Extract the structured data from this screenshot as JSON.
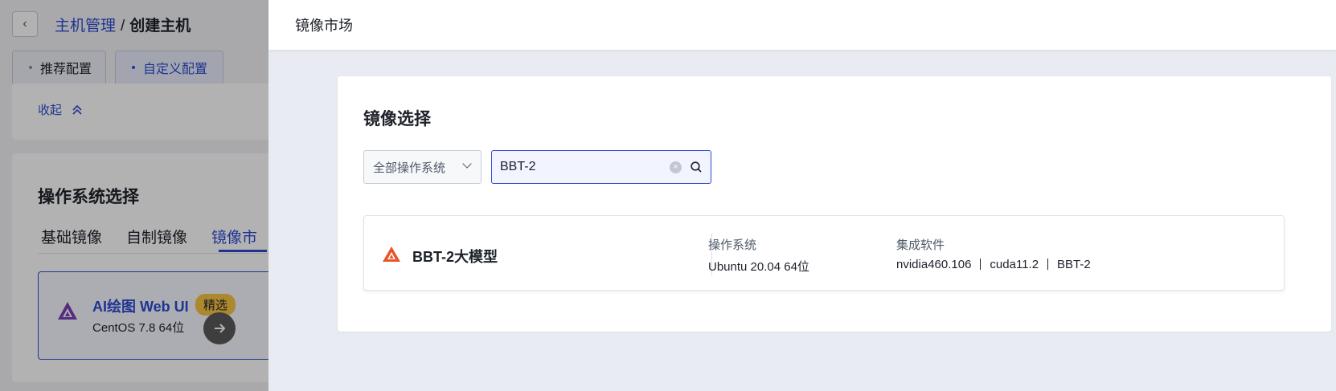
{
  "background": {
    "breadcrumb": {
      "parent": "主机管理",
      "separator": "/",
      "current": "创建主机"
    },
    "config_tabs": [
      {
        "label": "推荐配置",
        "active": false
      },
      {
        "label": "自定义配置",
        "active": true
      }
    ],
    "collapse_label": "收起",
    "os_section": {
      "title": "操作系统选择",
      "tabs": [
        {
          "label": "基础镜像",
          "active": false
        },
        {
          "label": "自制镜像",
          "active": false
        },
        {
          "label": "镜像市",
          "active": true
        }
      ],
      "image_card": {
        "name": "AI绘图 Web UI",
        "badge": "精选",
        "os": "CentOS 7.8 64位",
        "icon": "triangle-logo-icon",
        "accent": "#7b3fb5"
      }
    }
  },
  "drawer": {
    "title": "镜像市场",
    "panel": {
      "title": "镜像选择",
      "os_filter": {
        "selected": "全部操作系统"
      },
      "search": {
        "value": "BBT-2",
        "placeholder": ""
      },
      "results": [
        {
          "name": "BBT-2大模型",
          "icon": "triangle-logo-icon",
          "icon_color": "#e8552a",
          "os_label": "操作系统",
          "os_value": "Ubuntu 20.04 64位",
          "software_label": "集成软件",
          "software": [
            "nvidia460.106",
            "cuda11.2",
            "BBT-2"
          ]
        }
      ]
    }
  },
  "colors": {
    "accent": "#2d4bd3",
    "badge": "#f6c343"
  }
}
